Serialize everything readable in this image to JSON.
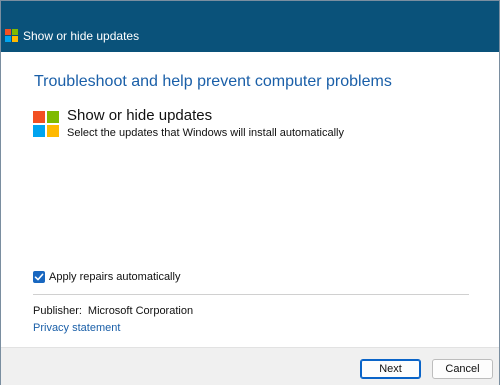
{
  "window": {
    "title": "Show or hide updates"
  },
  "content": {
    "heading": "Troubleshoot and help prevent computer problems",
    "app_title": "Show or hide updates",
    "app_subtitle": "Select the updates that Windows will install automatically",
    "logo_icon": "windows-logo-icon",
    "logo_colors": [
      "#f25022",
      "#7fba00",
      "#00a4ef",
      "#ffb900"
    ]
  },
  "options": {
    "apply_repairs_label": "Apply repairs automatically",
    "apply_repairs_checked": true
  },
  "publisher": {
    "label": "Publisher:",
    "value": "Microsoft Corporation",
    "privacy_link": "Privacy statement"
  },
  "buttons": {
    "next_label": "Next",
    "cancel_label": "Cancel"
  }
}
